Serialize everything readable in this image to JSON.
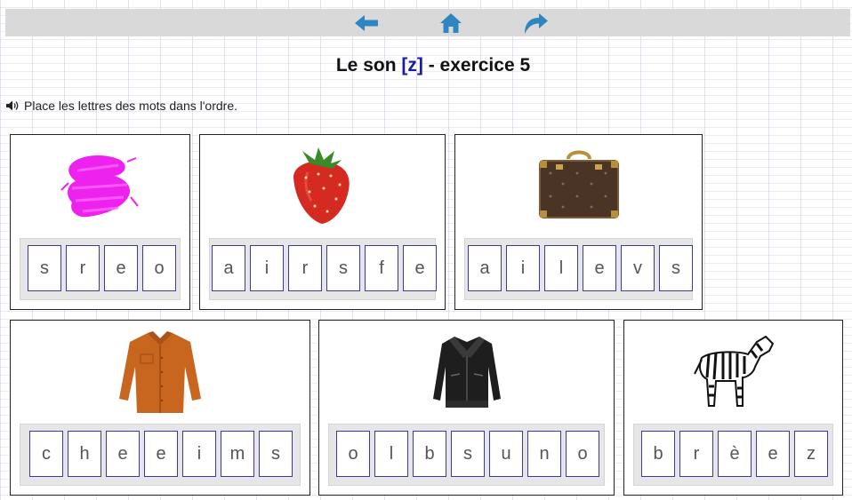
{
  "toolbar": {
    "buttons": [
      {
        "icon": "back-arrow-icon"
      },
      {
        "icon": "home-icon"
      },
      {
        "icon": "redo-icon"
      }
    ],
    "icon_color": "#2e86c1"
  },
  "title": {
    "prefix": "Le son ",
    "phoneme": "[z]",
    "suffix": " - exercice 5"
  },
  "instruction": {
    "icon": "speaker-icon",
    "text": "Place les lettres des mots dans l'ordre."
  },
  "cards": [
    {
      "picture": "pink-scribble",
      "letters": [
        "s",
        "r",
        "e",
        "o"
      ]
    },
    {
      "picture": "strawberry",
      "letters": [
        "a",
        "i",
        "r",
        "s",
        "f",
        "e"
      ]
    },
    {
      "picture": "suitcase",
      "letters": [
        "a",
        "i",
        "l",
        "e",
        "v",
        "s"
      ]
    },
    {
      "picture": "shirt",
      "letters": [
        "c",
        "h",
        "e",
        "e",
        "i",
        "m",
        "s"
      ]
    },
    {
      "picture": "leather-jacket",
      "letters": [
        "o",
        "l",
        "b",
        "s",
        "u",
        "n",
        "o"
      ]
    },
    {
      "picture": "zebra",
      "letters": [
        "b",
        "r",
        "è",
        "e",
        "z"
      ]
    }
  ]
}
